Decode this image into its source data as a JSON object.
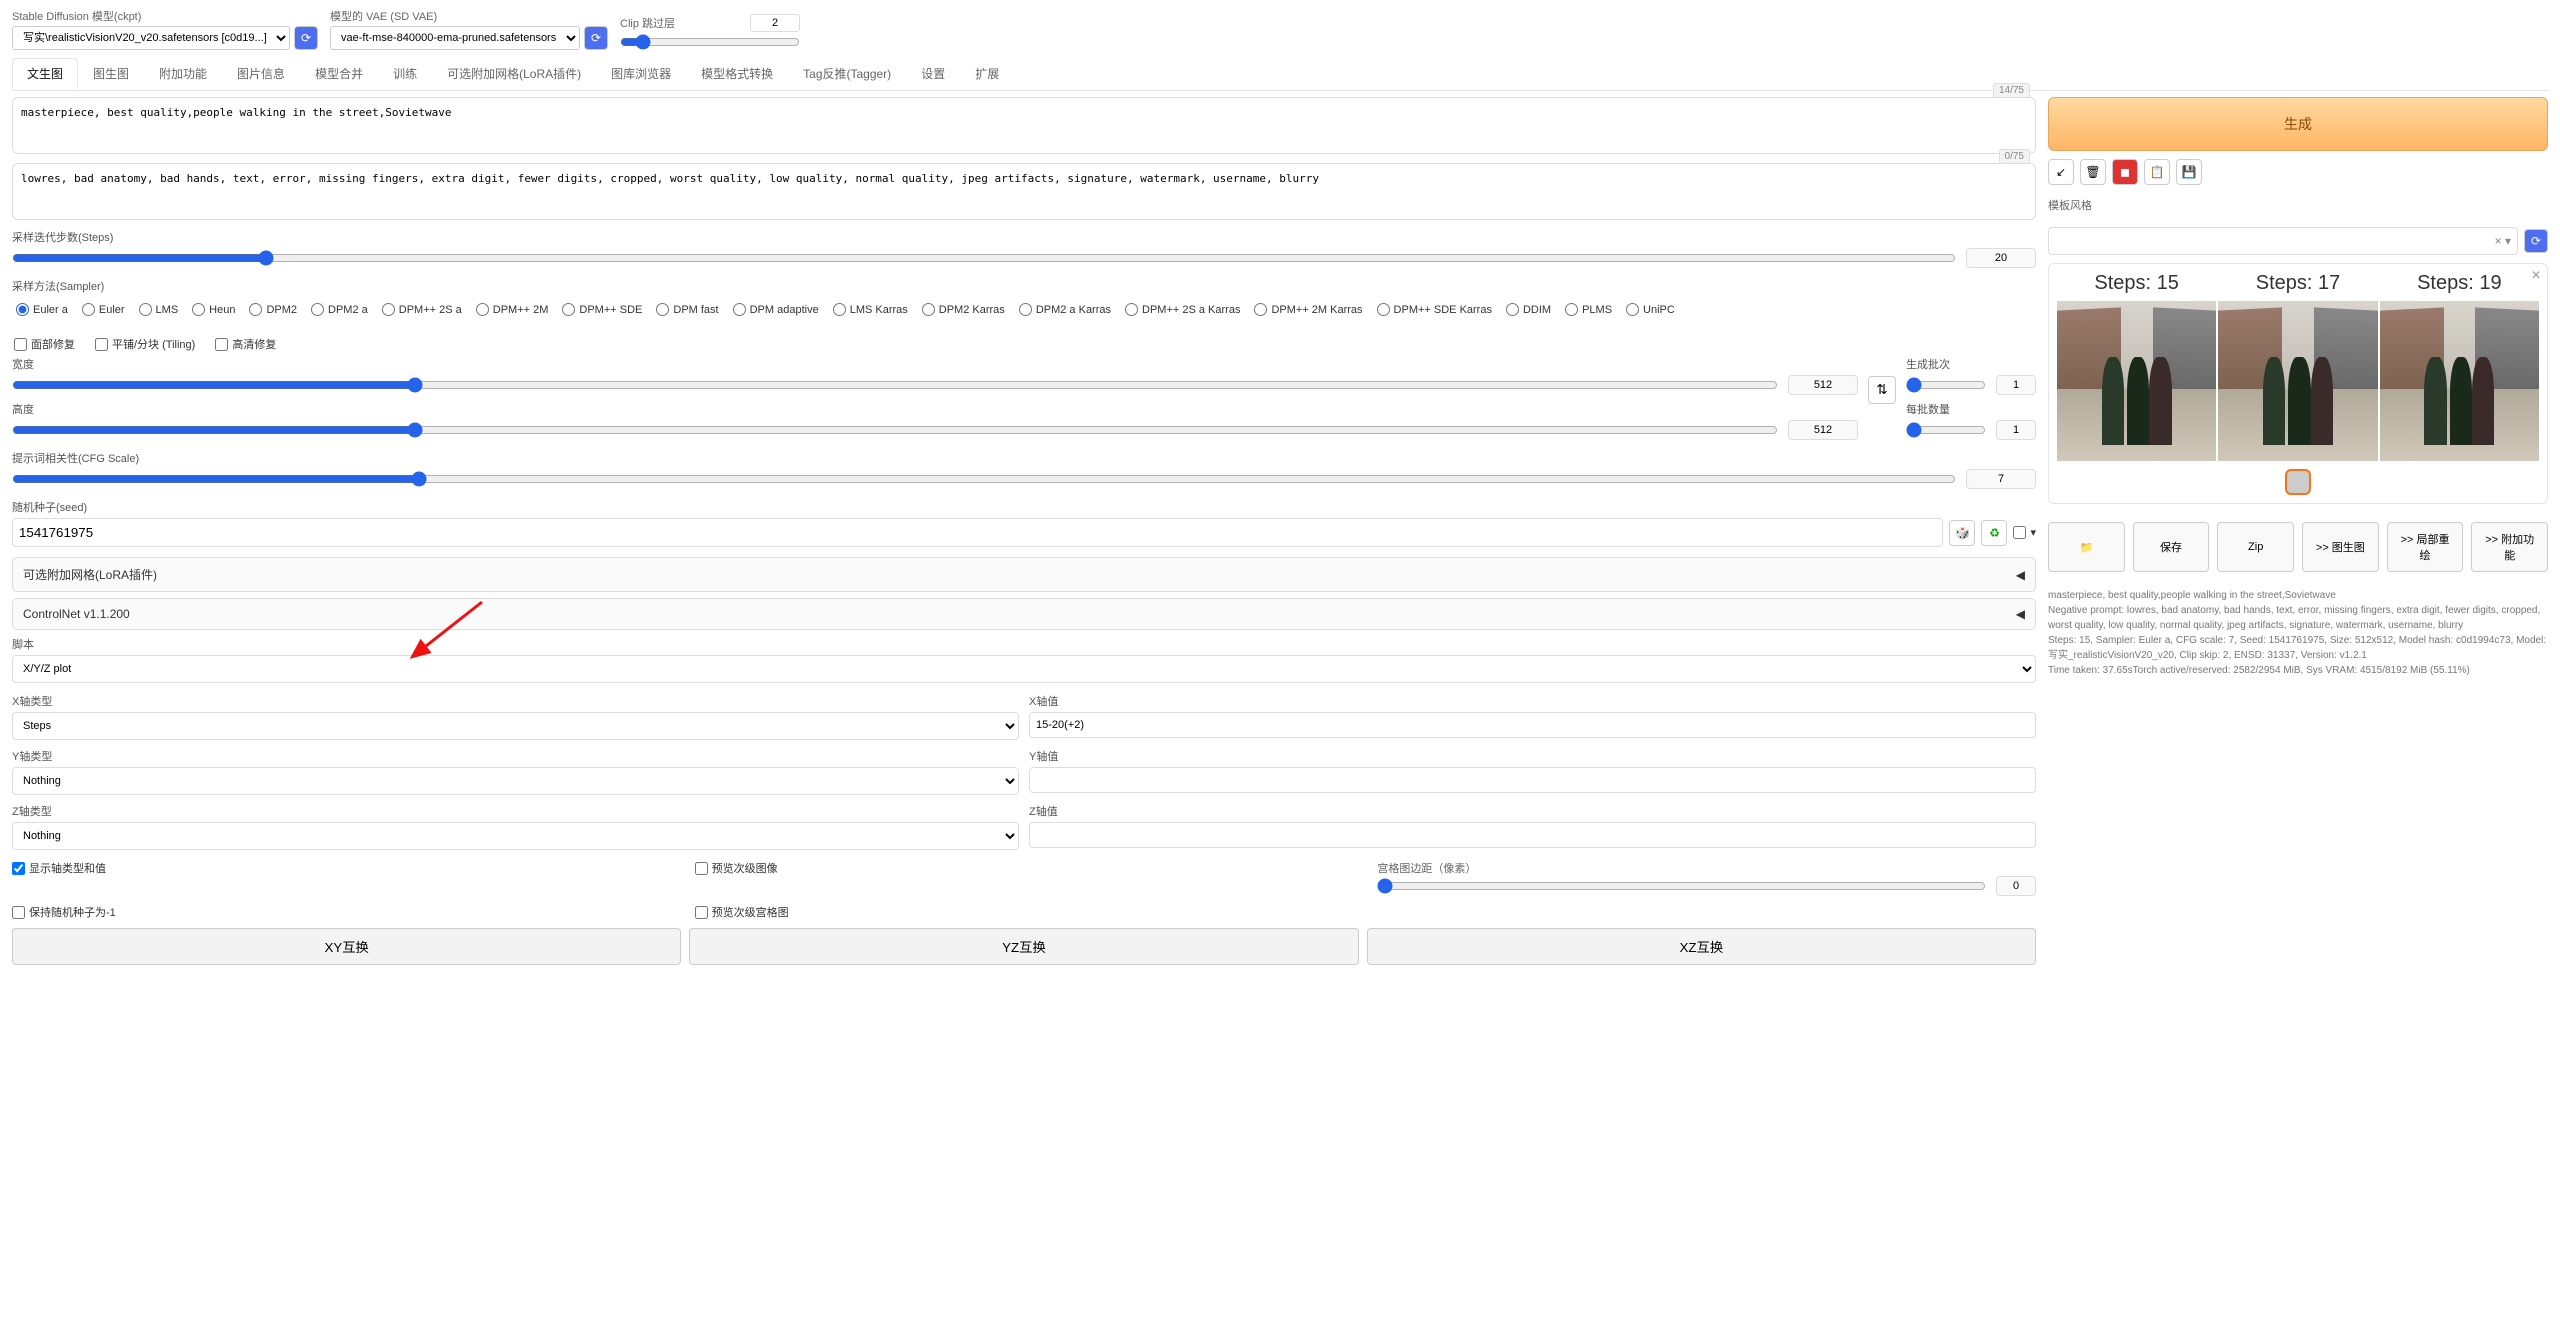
{
  "top": {
    "checkpoint_label": "Stable Diffusion 模型(ckpt)",
    "checkpoint_value": "写实\\realisticVisionV20_v20.safetensors [c0d19...]",
    "vae_label": "模型的 VAE (SD VAE)",
    "vae_value": "vae-ft-mse-840000-ema-pruned.safetensors",
    "clip_label": "Clip 跳过层",
    "clip_value": "2"
  },
  "tabs": [
    "文生图",
    "图生图",
    "附加功能",
    "图片信息",
    "模型合并",
    "训练",
    "可选附加网格(LoRA插件)",
    "图库浏览器",
    "模型格式转换",
    "Tag反推(Tagger)",
    "设置",
    "扩展"
  ],
  "active_tab": 0,
  "prompt": {
    "pos": "masterpiece, best quality,people walking in the street,Sovietwave",
    "pos_tokens": "14/75",
    "neg": "lowres, bad anatomy, bad hands, text, error, missing fingers, extra digit, fewer digits, cropped, worst quality, low quality, normal quality, jpeg artifacts, signature, watermark, username, blurry",
    "neg_tokens": "0/75"
  },
  "generate_label": "生成",
  "style_label": "模板风格",
  "steps": {
    "label": "采样迭代步数(Steps)",
    "value": "20"
  },
  "sampler_label": "采样方法(Sampler)",
  "samplers": [
    "Euler a",
    "Euler",
    "LMS",
    "Heun",
    "DPM2",
    "DPM2 a",
    "DPM++ 2S a",
    "DPM++ 2M",
    "DPM++ SDE",
    "DPM fast",
    "DPM adaptive",
    "LMS Karras",
    "DPM2 Karras",
    "DPM2 a Karras",
    "DPM++ 2S a Karras",
    "DPM++ 2M Karras",
    "DPM++ SDE Karras",
    "DDIM",
    "PLMS",
    "UniPC"
  ],
  "sampler_selected": "Euler a",
  "checks": {
    "face": "面部修复",
    "tiling": "平铺/分块 (Tiling)",
    "hires": "高清修复"
  },
  "width": {
    "label": "宽度",
    "value": "512"
  },
  "height": {
    "label": "高度",
    "value": "512"
  },
  "batch_count": {
    "label": "生成批次",
    "value": "1"
  },
  "batch_size": {
    "label": "每批数量",
    "value": "1"
  },
  "cfg": {
    "label": "提示词相关性(CFG Scale)",
    "value": "7"
  },
  "seed": {
    "label": "随机种子(seed)",
    "value": "1541761975"
  },
  "accordion1": "可选附加网格(LoRA插件)",
  "accordion2": "ControlNet v1.1.200",
  "script": {
    "label": "脚本",
    "value": "X/Y/Z plot"
  },
  "xyz": {
    "x_type_label": "X轴类型",
    "x_type": "Steps",
    "x_val_label": "X轴值",
    "x_val": "15-20(+2)",
    "y_type_label": "Y轴类型",
    "y_type": "Nothing",
    "y_val_label": "Y轴值",
    "y_val": "",
    "z_type_label": "Z轴类型",
    "z_type": "Nothing",
    "z_val_label": "Z轴值",
    "z_val": ""
  },
  "xyz_checks": {
    "legend": "显示轴类型和值",
    "keep_seed": "保持随机种子为-1",
    "sub_img": "预览次级图像",
    "sub_grid": "预览次级宫格图",
    "margin_label": "宫格图边距（像素）",
    "margin_value": "0"
  },
  "swap": {
    "xy": "XY互换",
    "yz": "YZ互换",
    "xz": "XZ互换"
  },
  "output": {
    "steps": [
      "Steps: 15",
      "Steps: 17",
      "Steps: 19"
    ],
    "actions": {
      "folder": "📁",
      "save": "保存",
      "zip": "Zip",
      "img2img": ">> 图生图",
      "inpaint": ">> 局部重绘",
      "extras": ">> 附加功能"
    },
    "meta1": "masterpiece, best quality,people walking in the street,Sovietwave",
    "meta2": "Negative prompt: lowres, bad anatomy, bad hands, text, error, missing fingers, extra digit, fewer digits, cropped, worst quality, low quality, normal quality, jpeg artifacts, signature, watermark, username, blurry",
    "meta3": "Steps: 15, Sampler: Euler a, CFG scale: 7, Seed: 1541761975, Size: 512x512, Model hash: c0d1994c73, Model: 写实_realisticVisionV20_v20, Clip skip: 2, ENSD: 31337, Version: v1.2.1",
    "meta4": "Time taken: 37.65sTorch active/reserved: 2582/2954 MiB, Sys VRAM: 4515/8192 MiB (55.11%)"
  }
}
